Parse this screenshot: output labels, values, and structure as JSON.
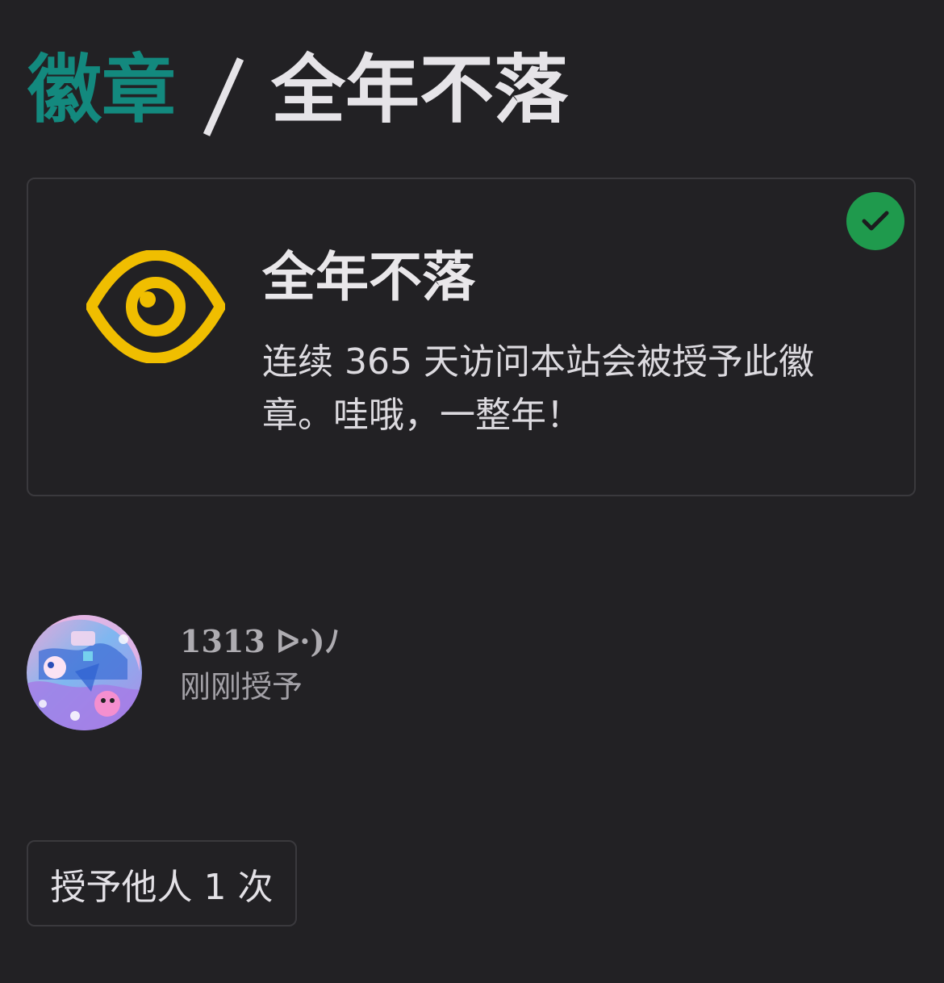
{
  "breadcrumb": {
    "parent": "徽章",
    "separator": "/",
    "current": "全年不落"
  },
  "badge": {
    "icon": "eye-icon",
    "title": "全年不落",
    "description": "连续 365 天访问本站会被授予此徽章。哇哦，一整年！",
    "granted_status_icon": "check-icon",
    "icon_color": "#f0be00",
    "status_color": "#1f9a4d"
  },
  "grantee": {
    "name": "1313 ᐅ·)ﾉ",
    "granted_time": "刚刚授予"
  },
  "actions": {
    "grant_label": "授予他人 1 次"
  },
  "colors": {
    "background": "#222124",
    "accent": "#13897e"
  }
}
